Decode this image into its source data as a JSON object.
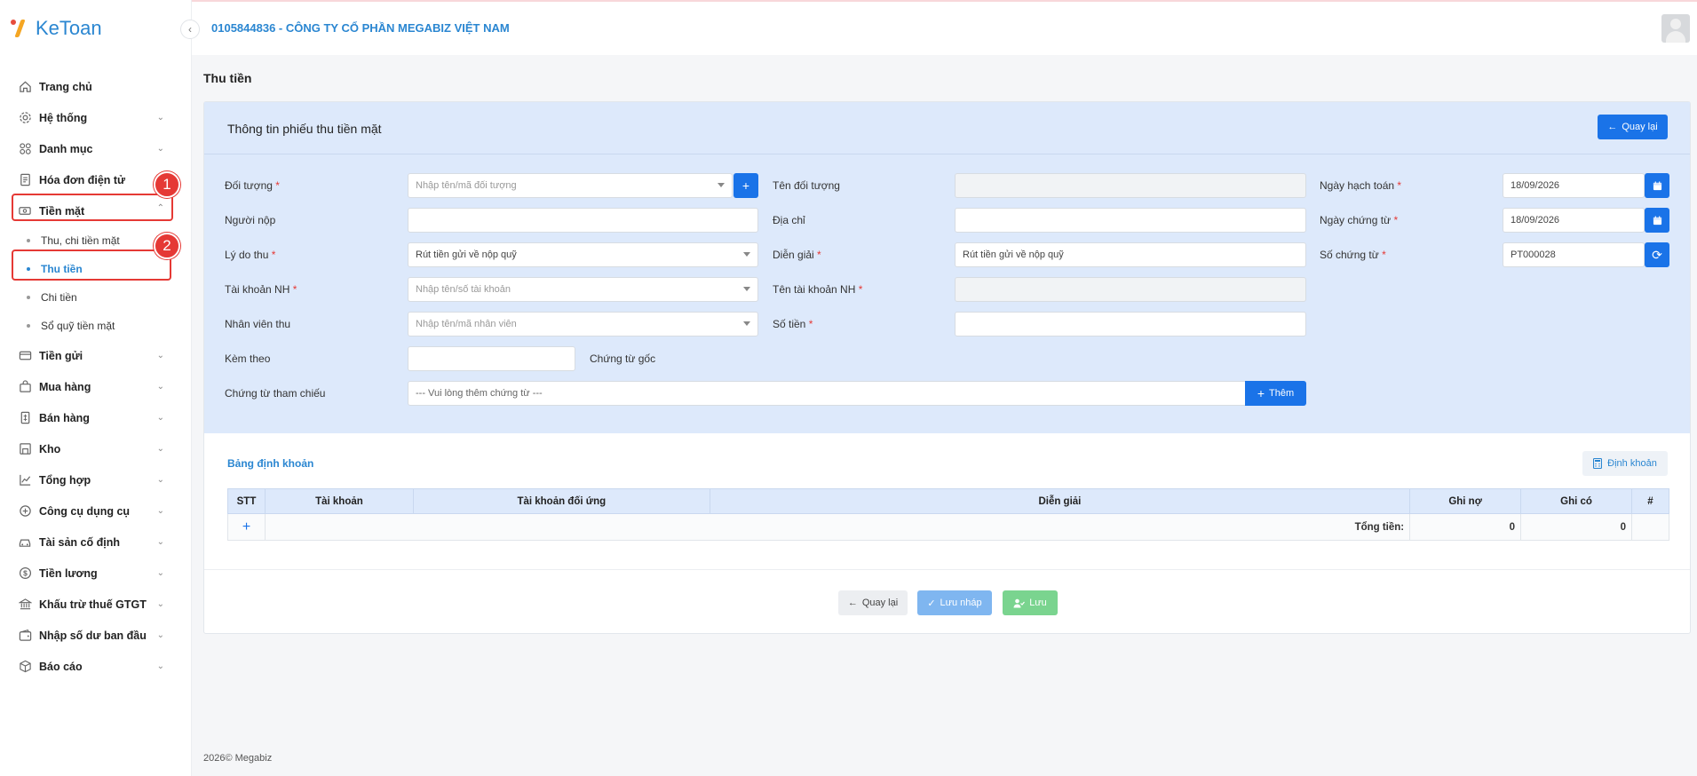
{
  "app": {
    "logo_text": "KeToan",
    "company": "0105844836 - CÔNG TY CỔ PHẦN MEGABIZ VIỆT NAM"
  },
  "sidebar": {
    "items": [
      {
        "label": "Trang chủ",
        "icon": "home-icon",
        "chevron": false
      },
      {
        "label": "Hệ thống",
        "icon": "gear-icon",
        "chevron": true
      },
      {
        "label": "Danh mục",
        "icon": "grid-icon",
        "chevron": true
      },
      {
        "label": "Hóa đơn điện tử",
        "icon": "invoice-icon",
        "chevron": false
      },
      {
        "label": "Tiền mặt",
        "icon": "cash-icon",
        "chevron": true,
        "expanded": true
      }
    ],
    "cash_sub": [
      {
        "label": "Thu, chi tiền mặt"
      },
      {
        "label": "Thu tiền",
        "active": true
      },
      {
        "label": "Chi tiền"
      },
      {
        "label": "Sổ quỹ tiền mặt"
      }
    ],
    "items_after": [
      {
        "label": "Tiền gửi",
        "icon": "card-icon"
      },
      {
        "label": "Mua hàng",
        "icon": "bag-icon"
      },
      {
        "label": "Bán hàng",
        "icon": "receipt-icon"
      },
      {
        "label": "Kho",
        "icon": "warehouse-icon"
      },
      {
        "label": "Tổng hợp",
        "icon": "chart-icon"
      },
      {
        "label": "Công cụ dụng cụ",
        "icon": "tools-icon"
      },
      {
        "label": "Tài sản cố định",
        "icon": "car-icon"
      },
      {
        "label": "Tiền lương",
        "icon": "dollar-icon"
      },
      {
        "label": "Khấu trừ thuế GTGT",
        "icon": "bank-icon"
      },
      {
        "label": "Nhập số dư ban đầu",
        "icon": "wallet-icon"
      },
      {
        "label": "Báo cáo",
        "icon": "box-icon"
      }
    ],
    "annotations": [
      "1",
      "2"
    ]
  },
  "page": {
    "title": "Thu tiền"
  },
  "form": {
    "title": "Thông tin phiếu thu tiền mặt",
    "back_label": "Quay lại",
    "doi_tuong_label": "Đối tượng",
    "doi_tuong_placeholder": "Nhập tên/mã đối tượng",
    "ten_doi_tuong_label": "Tên đối tượng",
    "ngay_hach_toan_label": "Ngày hạch toán",
    "ngay_hach_toan_value": "18/09/2026",
    "nguoi_nop_label": "Người nộp",
    "dia_chi_label": "Địa chỉ",
    "ngay_chung_tu_label": "Ngày chứng từ",
    "ngay_chung_tu_value": "18/09/2026",
    "ly_do_thu_label": "Lý do thu",
    "ly_do_thu_value": "Rút tiền gửi về nộp quỹ",
    "dien_giai_label": "Diễn giải",
    "dien_giai_value": "Rút tiền gửi về nộp quỹ",
    "so_chung_tu_label": "Số chứng từ",
    "so_chung_tu_value": "PT000028",
    "tai_khoan_nh_label": "Tài khoản NH",
    "tai_khoan_nh_placeholder": "Nhập tên/số tài khoản",
    "ten_tai_khoan_nh_label": "Tên tài khoản NH",
    "nhan_vien_thu_label": "Nhân viên thu",
    "nhan_vien_thu_placeholder": "Nhập tên/mã nhân viên",
    "so_tien_label": "Số tiền",
    "kem_theo_label": "Kèm theo",
    "chung_tu_goc_label": "Chứng từ gốc",
    "chung_tu_tham_chieu_label": "Chứng từ tham chiếu",
    "chung_tu_tham_chieu_placeholder": "--- Vui lòng thêm chứng từ ---",
    "them_label": "Thêm",
    "required_mark": "*"
  },
  "ledger": {
    "title": "Bảng định khoản",
    "dinh_khoan_label": "Định khoản",
    "columns": [
      "STT",
      "Tài khoản",
      "Tài khoản đối ứng",
      "Diễn giải",
      "Ghi nợ",
      "Ghi có",
      "#"
    ],
    "add_symbol": "+",
    "total_label": "Tổng tiền:",
    "total_debit": "0",
    "total_credit": "0"
  },
  "actions": {
    "back": "Quay lại",
    "save_draft": "Lưu nháp",
    "save": "Lưu"
  },
  "footer": {
    "copyright": "2026© Megabiz"
  }
}
